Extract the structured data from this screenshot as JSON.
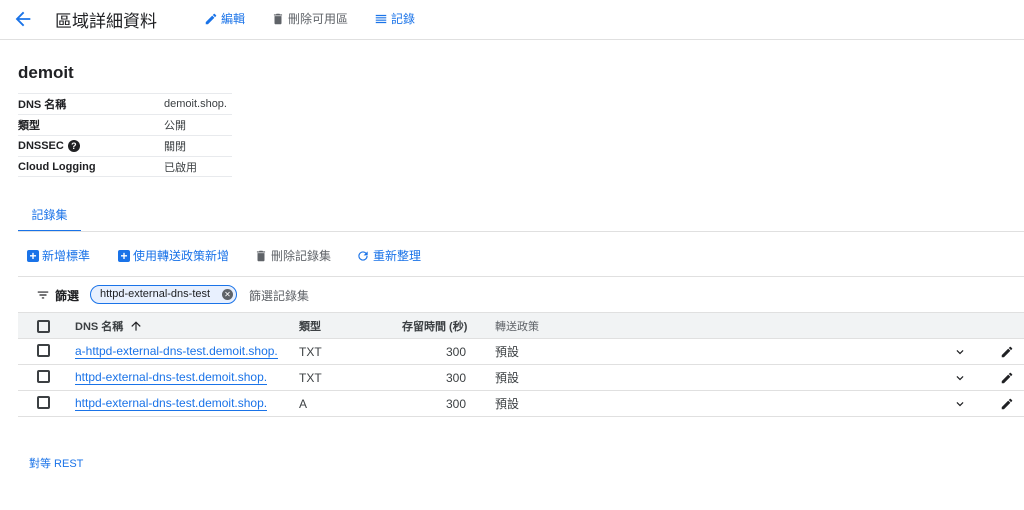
{
  "header": {
    "title": "區域詳細資料",
    "edit_label": "編輯",
    "delete_label": "刪除可用區",
    "logs_label": "記錄"
  },
  "zone": {
    "name": "demoit",
    "details": [
      {
        "label": "DNS 名稱",
        "value": "demoit.shop."
      },
      {
        "label": "類型",
        "value": "公開"
      },
      {
        "label": "DNSSEC",
        "value": "關閉"
      },
      {
        "label": "Cloud Logging",
        "value": "已啟用"
      }
    ]
  },
  "tab": {
    "label": "記錄集"
  },
  "toolbar": {
    "add_standard": "新增標準",
    "add_policy": "使用轉送政策新增",
    "delete_records": "刪除記錄集",
    "refresh": "重新整理"
  },
  "filter": {
    "label": "篩選",
    "chip": "httpd-external-dns-test",
    "placeholder": "篩選記錄集"
  },
  "table": {
    "headers": {
      "name": "DNS 名稱",
      "type": "類型",
      "ttl": "存留時間 (秒)",
      "policy": "轉送政策"
    },
    "rows": [
      {
        "name": "a-httpd-external-dns-test.demoit.shop.",
        "type": "TXT",
        "ttl": "300",
        "policy": "預設"
      },
      {
        "name": "httpd-external-dns-test.demoit.shop.",
        "type": "TXT",
        "ttl": "300",
        "policy": "預設"
      },
      {
        "name": "httpd-external-dns-test.demoit.shop.",
        "type": "A",
        "ttl": "300",
        "policy": "預設"
      }
    ]
  },
  "footer": {
    "rest_label": "對等 REST"
  },
  "colors": {
    "accent": "#1a73e8",
    "text": "#202124",
    "muted": "#5f6368"
  }
}
